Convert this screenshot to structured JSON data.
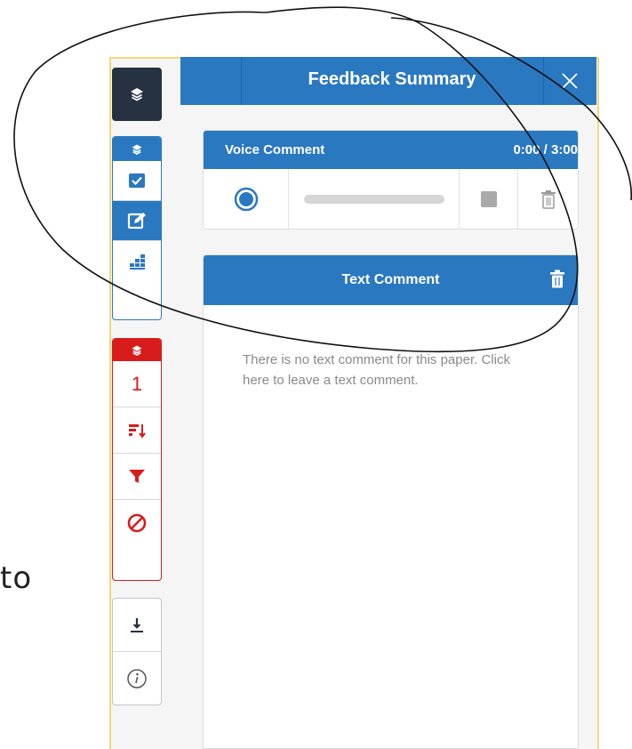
{
  "background_text": "to",
  "panel": {
    "title": "Feedback Summary",
    "close_icon": "close-icon"
  },
  "voice_comment": {
    "title": "Voice Comment",
    "time": "0:00 / 3:00",
    "progress": 0,
    "icons": [
      "record-icon",
      "stop-icon",
      "trash-icon"
    ]
  },
  "text_comment": {
    "title": "Text Comment",
    "empty_message": "There is no text comment for this paper. Click here to leave a text comment."
  },
  "toolbar": {
    "top_icon": "layers-icon",
    "blue_group": [
      "layers-icon",
      "checkbox-icon",
      "edit-icon",
      "rubric-grid-icon"
    ],
    "red_group": {
      "header_icon": "layers-icon",
      "count": "1",
      "icons": [
        "sort-icon",
        "filter-icon",
        "block-icon"
      ]
    },
    "util_group": [
      "download-icon",
      "info-icon"
    ]
  },
  "colors": {
    "primary_blue": "#2a78c0",
    "dark_navy": "#263142",
    "red": "#d81c1c",
    "frame_yellow": "#f3d77a"
  }
}
